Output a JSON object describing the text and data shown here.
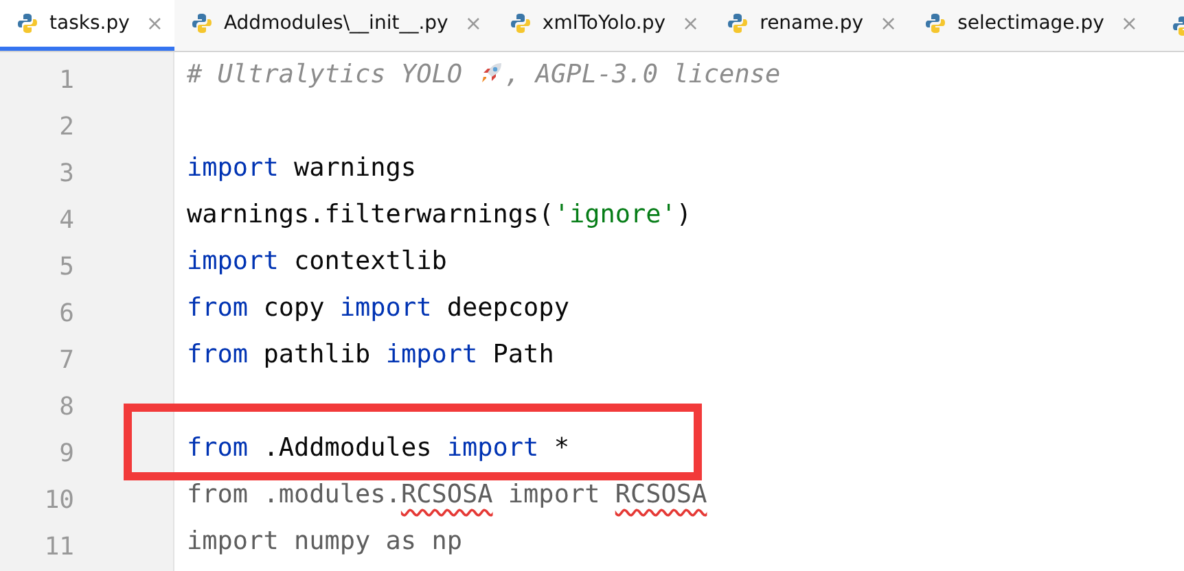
{
  "tabs": [
    {
      "label": "tasks.py",
      "selected": true
    },
    {
      "label": "Addmodules\\__init__.py",
      "selected": false
    },
    {
      "label": "xmlToYolo.py",
      "selected": false
    },
    {
      "label": "rename.py",
      "selected": false
    },
    {
      "label": "selectimage.py",
      "selected": false
    }
  ],
  "tab_close": "×",
  "lines": [
    {
      "number": "1",
      "highlighted": false,
      "tokens": [
        {
          "kind": "comment",
          "text": "# Ultralytics YOLO "
        },
        {
          "kind": "rocket"
        },
        {
          "kind": "comment",
          "text": ", AGPL-3.0 license"
        }
      ]
    },
    {
      "number": "2",
      "highlighted": false
    },
    {
      "number": "3",
      "highlighted": false,
      "tokens": [
        {
          "kind": "keyword",
          "text": "import"
        },
        {
          "kind": "plain",
          "text": " warnings"
        }
      ]
    },
    {
      "number": "4",
      "highlighted": false,
      "tokens": [
        {
          "kind": "plain",
          "text": "warnings.filterwarnings("
        },
        {
          "kind": "string",
          "text": "'ignore'"
        },
        {
          "kind": "plain",
          "text": ")"
        }
      ]
    },
    {
      "number": "5",
      "highlighted": false,
      "tokens": [
        {
          "kind": "keyword",
          "text": "import"
        },
        {
          "kind": "plain",
          "text": " contextlib"
        }
      ]
    },
    {
      "number": "6",
      "highlighted": false,
      "tokens": [
        {
          "kind": "keyword",
          "text": "from"
        },
        {
          "kind": "plain",
          "text": " copy "
        },
        {
          "kind": "keyword",
          "text": "import"
        },
        {
          "kind": "plain",
          "text": " deepcopy"
        }
      ]
    },
    {
      "number": "7",
      "highlighted": false,
      "tokens": [
        {
          "kind": "keyword",
          "text": "from"
        },
        {
          "kind": "plain",
          "text": " pathlib "
        },
        {
          "kind": "keyword",
          "text": "import"
        },
        {
          "kind": "plain",
          "text": " Path"
        }
      ]
    },
    {
      "number": "8",
      "highlighted": false
    },
    {
      "number": "9",
      "highlighted": true,
      "tokens": [
        {
          "kind": "keyword",
          "text": "from"
        },
        {
          "kind": "plain",
          "text": " .Addmodules "
        },
        {
          "kind": "keyword",
          "text": "import"
        },
        {
          "kind": "plain",
          "text": " *"
        }
      ]
    },
    {
      "number": "10",
      "highlighted": false,
      "tokens": [
        {
          "kind": "unused",
          "text": "from .modules."
        },
        {
          "kind": "error",
          "text": "RCSOSA"
        },
        {
          "kind": "unused",
          "text": " import "
        },
        {
          "kind": "error",
          "text": "RCSOSA"
        }
      ]
    },
    {
      "number": "11",
      "highlighted": false,
      "tokens": [
        {
          "kind": "unused",
          "text": "import numpy as np"
        }
      ]
    }
  ]
}
